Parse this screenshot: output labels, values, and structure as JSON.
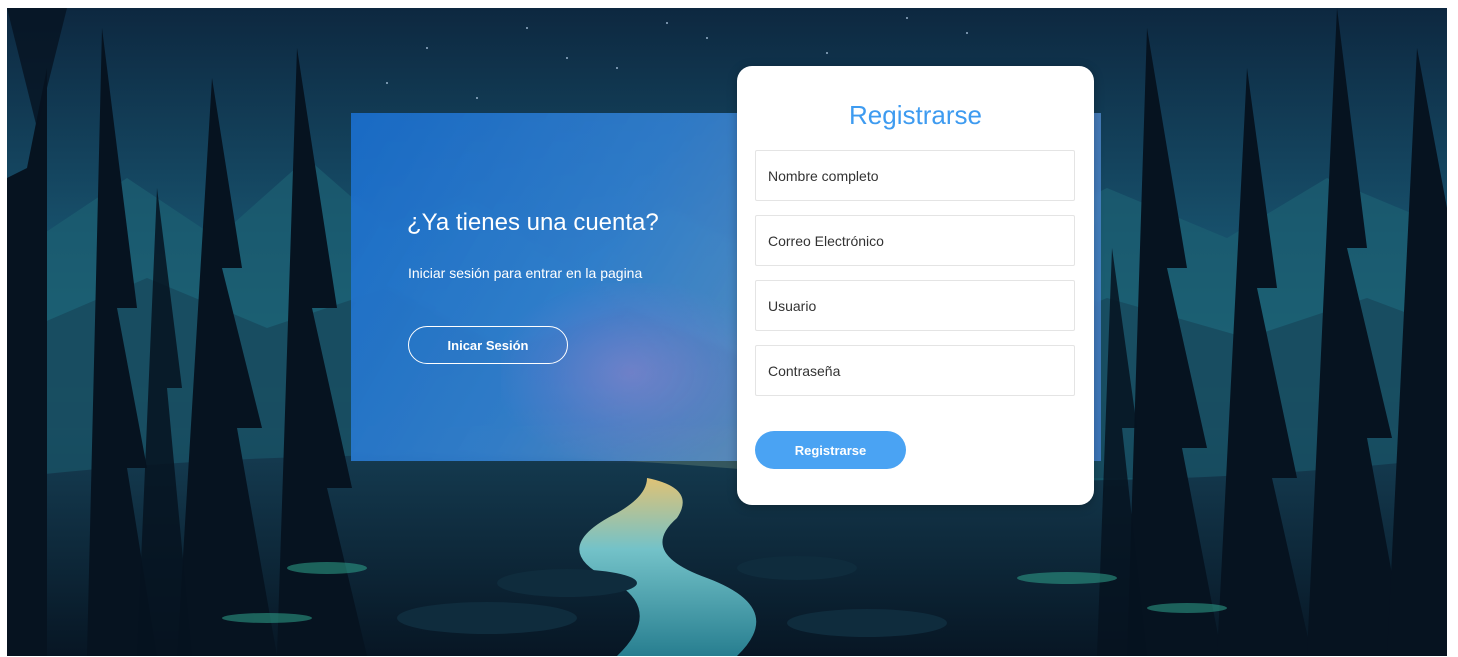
{
  "login_panel": {
    "question": "¿Ya tienes una cuenta?",
    "hint": "Iniciar sesión para entrar en la pagina",
    "login_button_label": "Inicar Sesión"
  },
  "register_form": {
    "title": "Registrarse",
    "fields": {
      "full_name_placeholder": "Nombre completo",
      "email_placeholder": "Correo Electrónico",
      "user_placeholder": "Usuario",
      "password_placeholder": "Contraseña"
    },
    "submit_label": "Registrarse"
  },
  "colors": {
    "accent": "#4aa3f3",
    "title": "#3e9bf0",
    "panel_blue": "#1a6ecd"
  }
}
